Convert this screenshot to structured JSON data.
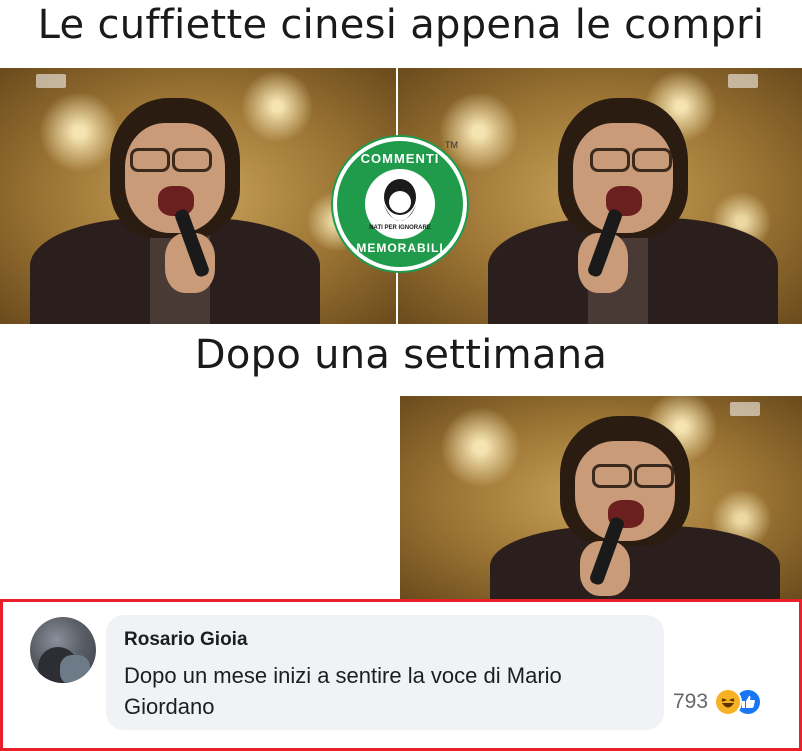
{
  "meme": {
    "caption_top": "Le cuffiette cinesi appena le compri",
    "caption_middle": "Dopo una settimana",
    "badge": {
      "top_text": "COMMENTI",
      "bottom_text": "MEMORABILI",
      "small_text": "NATI PER IGNORARE",
      "tm": "TM",
      "color": "#1f9b4b"
    }
  },
  "comment": {
    "author": "Rosario Gioia",
    "text": "Dopo un mese inizi a sentire la voce di Mario Giordano",
    "reaction_count": "793",
    "reactions": [
      "haha-icon",
      "like-icon"
    ],
    "highlight_color": "#e8202a"
  }
}
